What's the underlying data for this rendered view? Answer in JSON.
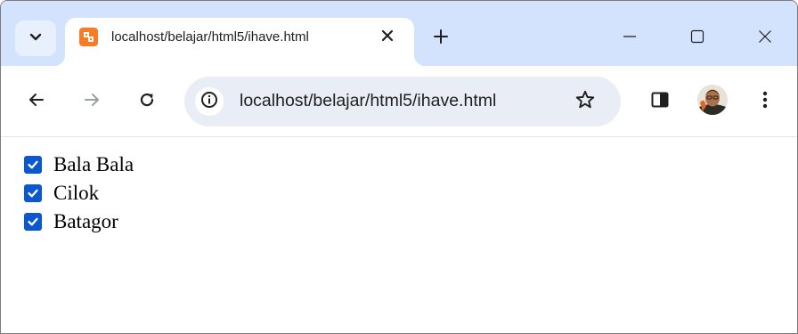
{
  "browser": {
    "tab": {
      "title": "localhost/belajar/html5/ihave.html",
      "favicon": "xampp-icon",
      "close_icon": "close-icon"
    },
    "new_tab_icon": "plus-icon",
    "tab_search_icon": "chevron-down-icon",
    "window_controls": [
      "minimize-icon",
      "maximize-icon",
      "close-icon"
    ],
    "toolbar": {
      "back_icon": "arrow-left-icon",
      "forward_icon": "arrow-right-icon",
      "reload_icon": "reload-icon",
      "site_info_icon": "info-icon",
      "url": "localhost/belajar/html5/ihave.html",
      "bookmark_icon": "star-icon",
      "side_panel_icon": "side-panel-icon",
      "profile_icon": "avatar",
      "menu_icon": "more-vert-icon"
    },
    "colors": {
      "tabstrip": "#d3e3fd",
      "omnibox": "#e9eef6",
      "checkbox_accent": "#0b57d0",
      "favicon": "#fb7a24"
    }
  },
  "page": {
    "checkboxes": [
      {
        "label": "Bala Bala",
        "checked": true
      },
      {
        "label": "Cilok",
        "checked": true
      },
      {
        "label": "Batagor",
        "checked": true
      }
    ]
  }
}
